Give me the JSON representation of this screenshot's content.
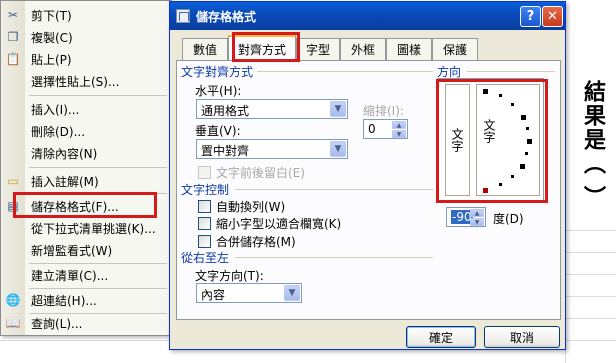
{
  "sheet": {
    "side_text": "結果是（ ）"
  },
  "context_menu": {
    "items": [
      {
        "label": "剪下(T)",
        "icon": "cut-icon"
      },
      {
        "label": "複製(C)",
        "icon": "copy-icon"
      },
      {
        "label": "貼上(P)",
        "icon": "paste-icon"
      },
      {
        "label": "選擇性貼上(S)...",
        "icon": ""
      },
      {
        "label": "插入(I)...",
        "icon": ""
      },
      {
        "label": "刪除(D)...",
        "icon": ""
      },
      {
        "label": "清除內容(N)",
        "icon": ""
      },
      {
        "label": "插入註解(M)",
        "icon": "comment-icon"
      },
      {
        "label": "儲存格格式(F)...",
        "icon": "format-cells-icon"
      },
      {
        "label": "從下拉式清單挑選(K)...",
        "icon": ""
      },
      {
        "label": "新增監看式(W)",
        "icon": ""
      },
      {
        "label": "建立清單(C)...",
        "icon": ""
      },
      {
        "label": "超連結(H)...",
        "icon": "hyperlink-icon"
      },
      {
        "label": "查詢(L)...",
        "icon": "lookup-icon"
      }
    ]
  },
  "dialog": {
    "title": "儲存格格式",
    "help_glyph": "?",
    "close_glyph": "✕",
    "tabs": [
      "數值",
      "對齊方式",
      "字型",
      "外框",
      "圖樣",
      "保護"
    ],
    "active_tab": "對齊方式",
    "text_alignment": {
      "section": "文字對齊方式",
      "horizontal_label": "水平(H):",
      "horizontal_value": "通用格式",
      "vertical_label": "垂直(V):",
      "vertical_value": "置中對齊",
      "indent_label": "縮排(I):",
      "indent_value": "0",
      "justify_distributed": "文字前後留白(E)"
    },
    "text_control": {
      "section": "文字控制",
      "wrap_text": "自動換列(W)",
      "shrink_to_fit": "縮小字型以適合欄寬(K)",
      "merge_cells": "合併儲存格(M)"
    },
    "right_to_left": {
      "section": "從右至左",
      "direction_label": "文字方向(T):",
      "direction_value": "內容"
    },
    "orientation": {
      "section": "方向",
      "vertical_text": "文字",
      "dial_text": "文字",
      "degrees_value": "-90",
      "degrees_label": "度(D)"
    },
    "ok": "確定",
    "cancel": "取消"
  },
  "colors": {
    "highlight": "#d61a1a",
    "titlebar": "#0a5fd8"
  }
}
